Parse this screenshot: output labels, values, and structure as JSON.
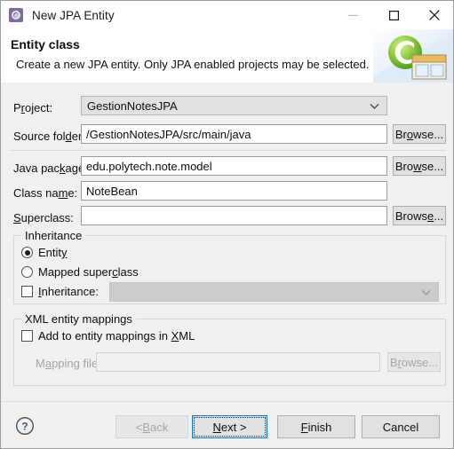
{
  "window": {
    "title": "New JPA Entity",
    "icon": "jpa-entity-gear-icon",
    "controls": {
      "minimize": "—",
      "maximize": "□",
      "close": "✕"
    }
  },
  "banner": {
    "title": "Entity class",
    "subtitle": "Create a new JPA entity. Only JPA enabled projects may be selected.",
    "art": "jpa-entity-banner-icon"
  },
  "form": {
    "project": {
      "label_before": "P",
      "label_mnemonic": "r",
      "label_after": "oject:",
      "value": "GestionNotesJPA",
      "type": "combo"
    },
    "source_folder": {
      "label_before": "Source fol",
      "label_mnemonic": "d",
      "label_after": "er:",
      "value": "/GestionNotesJPA/src/main/java",
      "browse": {
        "before": "Br",
        "mnemonic": "o",
        "after": "wse..."
      }
    },
    "java_package": {
      "label_before": "Java pac",
      "label_mnemonic": "k",
      "label_after": "age:",
      "value": "edu.polytech.note.model",
      "browse": {
        "before": "Bro",
        "mnemonic": "w",
        "after": "se..."
      }
    },
    "class_name": {
      "label_before": "Class na",
      "label_mnemonic": "m",
      "label_after": "e:",
      "value": "NoteBean"
    },
    "superclass": {
      "label_before": "",
      "label_mnemonic": "S",
      "label_after": "uperclass:",
      "value": "",
      "browse": {
        "before": "Brows",
        "mnemonic": "e",
        "after": "..."
      }
    }
  },
  "inheritance_group": {
    "title": "Inheritance",
    "entity_radio": {
      "before": "Entit",
      "mnemonic": "y",
      "after": "",
      "checked": true
    },
    "mapped_superclass_radio": {
      "before": "Mapped super",
      "mnemonic": "c",
      "after": "lass",
      "checked": false
    },
    "inheritance_check": {
      "before": "",
      "mnemonic": "I",
      "after": "nheritance:",
      "checked": false
    },
    "inheritance_combo": {
      "value": "",
      "disabled": true
    }
  },
  "xml_group": {
    "title": "XML entity mappings",
    "add_check": {
      "before": "Add to entity mappings in ",
      "mnemonic": "X",
      "after": "ML",
      "checked": false
    },
    "mapping_file": {
      "label_before": "M",
      "label_mnemonic": "a",
      "label_after": "pping file:",
      "value": "",
      "disabled": true,
      "browse": {
        "before": "B",
        "mnemonic": "r",
        "after": "owse...",
        "disabled": true
      }
    }
  },
  "footer": {
    "help_icon": "help-question-icon",
    "back": {
      "before": "< ",
      "mnemonic": "B",
      "after": "ack",
      "disabled": true
    },
    "next": {
      "before": "",
      "mnemonic": "N",
      "after": "ext >",
      "default": true
    },
    "finish": {
      "before": "",
      "mnemonic": "F",
      "after": "inish"
    },
    "cancel": {
      "before": "Cancel",
      "mnemonic": "",
      "after": ""
    }
  },
  "colors": {
    "dialog_bg": "#f0f0f0",
    "field_bg": "#ffffff",
    "accent_focus": "#0078d7",
    "title_icon": "#7d6a9e",
    "banner_green": "#7ec13d"
  }
}
